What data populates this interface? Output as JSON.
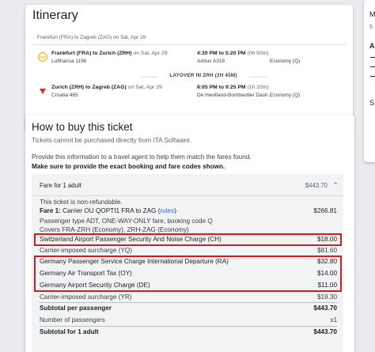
{
  "itinerary": {
    "title": "Itinerary",
    "route": "Frankfurt (FRA) to Zagreb (ZAG) on Sat, Apr 29",
    "segments": [
      {
        "route": "Frankfurt (FRA) to Zurich (ZRH)",
        "date": "on Sat, Apr 29",
        "carrier": "Lufthansa 1196",
        "time": "4:30 PM to 5:20 PM",
        "duration": "(0h 50m)",
        "aircraft": "Airbus A319",
        "cabin": "Economy (Q)"
      },
      {
        "route": "Zurich (ZRH) to Zagreb (ZAG)",
        "date": "on Sat, Apr 29",
        "carrier": "Croatia 465",
        "time": "8:05 PM to 9:25 PM",
        "duration": "(1h 20m)",
        "aircraft": "De Havilland-Bombardier Dash...",
        "cabin": "Economy (Q)"
      }
    ],
    "layover": "LAYOVER IN ZRH (2H 45M)"
  },
  "side_panel": {
    "m": "M",
    "line": "5",
    "a": "A",
    "s": "S"
  },
  "buy": {
    "title": "How to buy this ticket",
    "subtitle": "Tickets cannot be purchased directly from ITA Software.",
    "info": "Provide this information to a travel agent to help them match the fares found.",
    "bold_info": "Make sure to provide the exact booking and fare codes shown.",
    "fare_header": {
      "label": "Fare for 1 adult",
      "amount": "$443.70"
    },
    "non_refundable": "This ticket is non-refundable.",
    "fare1": {
      "label": "Fare 1:",
      "text": "Carrier OU QOPTI1 FRA to ZAG (",
      "link": "rules",
      "close": ")",
      "amount": "$266.81"
    },
    "passenger_type": "Passenger type ADT, ONE-WAY-ONLY fare, booking code Q",
    "covers": "Covers FRA-ZRH (Economy), ZRH-ZAG (Economy)",
    "taxes": [
      {
        "label": "Switzerland Airport Passenger Security And Noise Charge (CH)",
        "amount": "$18.00"
      },
      {
        "label": "Carrier-imposed surcharge (YQ)",
        "amount": "$81.60"
      },
      {
        "label": "Germany Passenger Service Charge International Departure (RA)",
        "amount": "$32.80"
      },
      {
        "label": "Germany Air Transport Tax (OY)",
        "amount": "$14.00"
      },
      {
        "label": "Germany Airport Security Charge (DE)",
        "amount": "$11.00"
      },
      {
        "label": "Carrier-imposed surcharge (YR)",
        "amount": "$19.30"
      }
    ],
    "subtotal_per_passenger": {
      "label": "Subtotal per passenger",
      "amount": "$443.70"
    },
    "num_passengers": {
      "label": "Number of passengers",
      "value": "x1"
    },
    "subtotal_adult": {
      "label": "Subtotal for 1 adult",
      "amount": "$443.70"
    }
  },
  "colors": {
    "highlight": "#c5221f",
    "link": "#1a73e8",
    "lufthansa": "#f9ab00",
    "croatia": "#d93025"
  },
  "icons": [
    "lufthansa-logo-icon",
    "croatia-airlines-logo-icon",
    "chevron-up-icon"
  ]
}
